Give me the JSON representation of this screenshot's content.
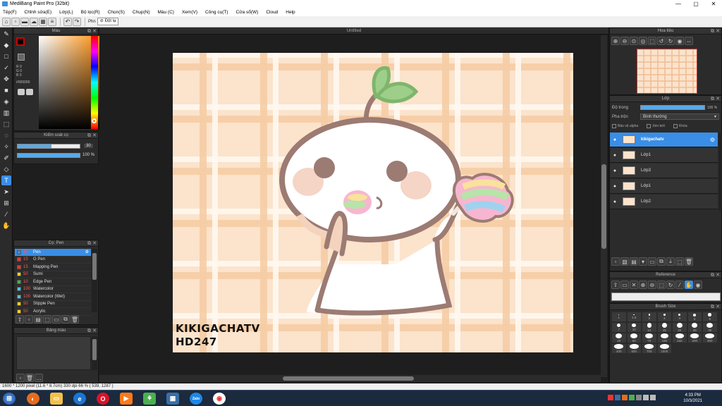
{
  "window": {
    "title": "MediBang Paint Pro (32bit)",
    "minimize": "—",
    "maximize": "▢",
    "close": "✕"
  },
  "menu": [
    "Tệp(F)",
    "Chỉnh sửa(E)",
    "Lớp(L)",
    "Bộ lọc(R)",
    "Chọn(S)",
    "Chụp(N)",
    "Màu (C)",
    "Xem(V)",
    "Công cụ(T)",
    "Cửa sổ(W)",
    "Cloud",
    "Help"
  ],
  "toolbar": {
    "phan_label": "Phn",
    "dot_label": "Đột lạ"
  },
  "color_panel": {
    "title": "Màu",
    "hex": "#000000",
    "r": "R 0",
    "g": "G 0",
    "b": "B 0"
  },
  "brush_control": {
    "title": "Kiểm soát cọ",
    "size_value": "30",
    "size_fill": 0.55,
    "opacity_value": "100 %",
    "opacity_fill": 1.0
  },
  "brush_panel": {
    "title": "Cọ: Pen",
    "items": [
      {
        "num": "30",
        "name": "Pen",
        "color": "#3a8ee6"
      },
      {
        "num": "15",
        "name": "G Pen",
        "color": "#e33"
      },
      {
        "num": "15",
        "name": "Mapping Pen",
        "color": "#e33"
      },
      {
        "num": "50",
        "name": "Sumi",
        "color": "#ffd21a"
      },
      {
        "num": "10",
        "name": "Edge Pen",
        "color": "#3bb54a"
      },
      {
        "num": "100",
        "name": "Watercolor",
        "color": "#49c6e5"
      },
      {
        "num": "100",
        "name": "Watercolor (Wet)",
        "color": "#49c6e5"
      },
      {
        "num": "50",
        "name": "Stipple Pen",
        "color": "#ffd21a"
      },
      {
        "num": "50",
        "name": "Acrylic",
        "color": "#ffd21a"
      }
    ]
  },
  "blend_panel": {
    "title": "Bảng màu"
  },
  "document": {
    "tab": "Untitled",
    "watermark_1": "KIKIGACHATV",
    "watermark_2": "HD247"
  },
  "navigator": {
    "title": "Hoa tiêu"
  },
  "layer_panel": {
    "title": "Lớp",
    "opacity_label": "Độ trong",
    "opacity_value": "100 %",
    "opacity_fill": 1.0,
    "blend_label": "Pha trộn",
    "blend_value": "Bình thường",
    "protect_alpha": "Bảo vệ alpha",
    "clip": "Xén bớt",
    "lock": "Khóa",
    "layers": [
      {
        "name": "kikigachatv",
        "selected": true
      },
      {
        "name": "Lớp1",
        "selected": false
      },
      {
        "name": "Lớp3",
        "selected": false
      },
      {
        "name": "Lớp1",
        "selected": false
      },
      {
        "name": "Lớp2",
        "selected": false
      }
    ]
  },
  "reference_panel": {
    "title": "Reference"
  },
  "brush_size_panel": {
    "title": "Brush Size",
    "sizes": [
      "1",
      "1.5",
      "2",
      "3",
      "4",
      "5",
      "6",
      "7",
      "10",
      "12",
      "15",
      "20",
      "25",
      "30",
      "40",
      "50",
      "70",
      "100",
      "150",
      "200",
      "300",
      "400",
      "500",
      "700",
      "1000"
    ]
  },
  "status": {
    "text": "1600 * 1200 pixel  (11.6 * 8.7cm)  330 dpi  66 %  ( 539, 1287 )"
  },
  "taskbar": {
    "time": "4:33 PM",
    "date": "10/3/2021"
  }
}
